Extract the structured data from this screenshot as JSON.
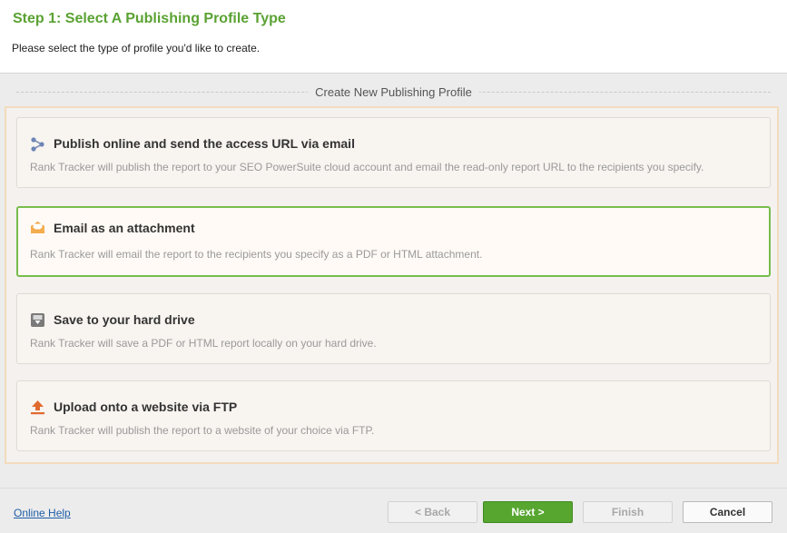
{
  "header": {
    "title": "Step 1: Select A Publishing Profile Type",
    "subtitle": "Please select the type of profile you'd like to create."
  },
  "section": {
    "title": "Create New Publishing Profile"
  },
  "options": [
    {
      "label": "Publish online and send the access URL via email",
      "description": "Rank Tracker will publish the report to your SEO PowerSuite cloud account and email the read-only report URL to the recipients you specify.",
      "icon": "share-icon",
      "selected": false
    },
    {
      "label": "Email as an attachment",
      "description": "Rank Tracker will email the report to the recipients you specify as a PDF or HTML attachment.",
      "icon": "envelope-icon",
      "selected": true
    },
    {
      "label": "Save to your hard drive",
      "description": "Rank Tracker will save a PDF or HTML report locally on your hard drive.",
      "icon": "save-disk-icon",
      "selected": false
    },
    {
      "label": "Upload onto a website via FTP",
      "description": "Rank Tracker will publish the report to a website of your choice via FTP.",
      "icon": "upload-arrow-icon",
      "selected": false
    }
  ],
  "footer": {
    "help_link": "Online Help",
    "back": "< Back",
    "next": "Next >",
    "finish": "Finish",
    "cancel": "Cancel"
  },
  "colors": {
    "title_green": "#5aa233",
    "selected_border": "#78bd4c",
    "primary_button": "#56a630",
    "panel_border": "#f2dcbd"
  }
}
